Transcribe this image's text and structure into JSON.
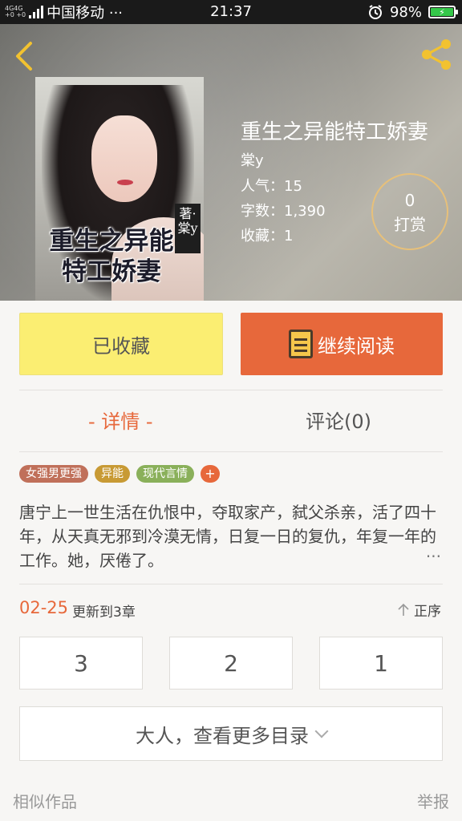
{
  "status_bar": {
    "network_top": "4G4G",
    "network_bottom": "+0 +0",
    "carrier": "中国移动 ···",
    "time": "21:37",
    "battery": "98%",
    "alarm_icon": "alarm-icon",
    "battery_color": "#35c84a"
  },
  "header": {
    "back_icon": "chevron-left-icon",
    "share_icon": "share-icon",
    "accent": "#f2c230"
  },
  "cover": {
    "title": "重生之异能特工娇妻",
    "seal": "著·棠y"
  },
  "book": {
    "title": "重生之异能特工娇妻",
    "author": "棠y",
    "popularity": "人气：15",
    "words": "字数：1,390",
    "favorites": "收藏：1",
    "tip_count": "0",
    "tip_label": "打赏"
  },
  "actions": {
    "favorited_label": "已收藏",
    "continue_label": "继续阅读",
    "favorited_color": "#fbee72",
    "continue_color": "#e7683b"
  },
  "tabs": {
    "detail": "- 详情 -",
    "comments": "评论(0)"
  },
  "tags": [
    {
      "label": "女强男更强",
      "color": "#c0705a"
    },
    {
      "label": "异能",
      "color": "#c89a34"
    },
    {
      "label": "现代言情",
      "color": "#8ab05a"
    }
  ],
  "tag_add": "+",
  "description": "唐宁上一世生活在仇恨中，夺取家产，弑父杀亲，活了四十年，从天真无邪到冷漠无情，日复一日的复仇，年复一年的工作。她，厌倦了。",
  "description_more": "···",
  "update": {
    "date": "02-25",
    "text": "更新到3章",
    "sort_label": "正序"
  },
  "chapters": [
    "3",
    "2",
    "1"
  ],
  "more_directory": "大人，查看更多目录",
  "footer": {
    "similar": "相似作品",
    "report": "举报"
  }
}
